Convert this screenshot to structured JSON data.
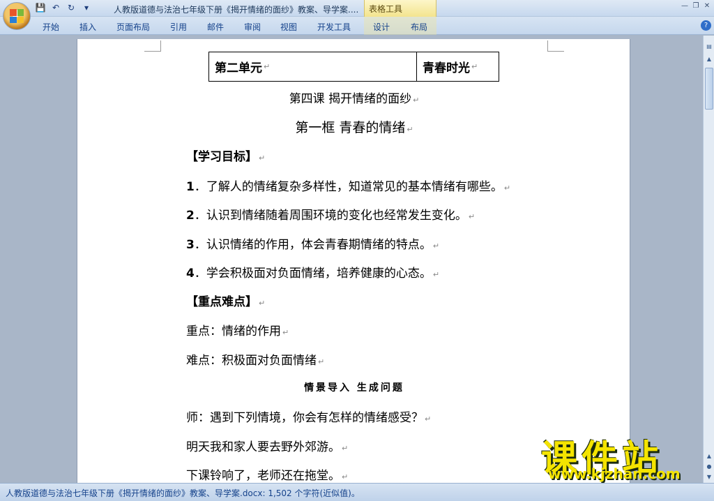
{
  "window": {
    "title": "人教版道德与法治七年级下册《揭开情绪的面纱》教案、导学案....",
    "context_tab_group": "表格工具"
  },
  "ribbon": {
    "tabs": [
      "开始",
      "插入",
      "页面布局",
      "引用",
      "邮件",
      "审阅",
      "视图",
      "开发工具",
      "设计",
      "布局"
    ]
  },
  "document": {
    "table": {
      "cell1": "第二单元",
      "cell2": "青春时光"
    },
    "lesson_title": "第四课  揭开情绪的面纱",
    "frame_title": "第一框  青春的情绪",
    "objectives_heading": "【学习目标】",
    "objectives": [
      {
        "num": "1",
        "text": "．了解人的情绪复杂多样性，知道常见的基本情绪有哪些。"
      },
      {
        "num": "2",
        "text": "．认识到情绪随着周围环境的变化也经常发生变化。"
      },
      {
        "num": "3",
        "text": "．认识情绪的作用，体会青春期情绪的特点。"
      },
      {
        "num": "4",
        "text": "．学会积极面对负面情绪，培养健康的心态。"
      }
    ],
    "key_heading": "【重点难点】",
    "key_point": "重点：情绪的作用",
    "difficult_point": "难点：积极面对负面情绪",
    "intro_heading": "情景导入  生成问题",
    "teacher_line": "师：遇到下列情境，你会有怎样的情绪感受？",
    "situation1": "明天我和家人要去野外郊游。",
    "situation2": "下课铃响了，老师还在拖堂。",
    "paragraph_mark": "↵"
  },
  "watermark": {
    "main": "课件站",
    "url": "www.kjzhan.com"
  },
  "status": {
    "text": "人教版道德与法治七年级下册《揭开情绪的面纱》教案、导学案.docx: 1,502 个字符(近似值)。"
  }
}
